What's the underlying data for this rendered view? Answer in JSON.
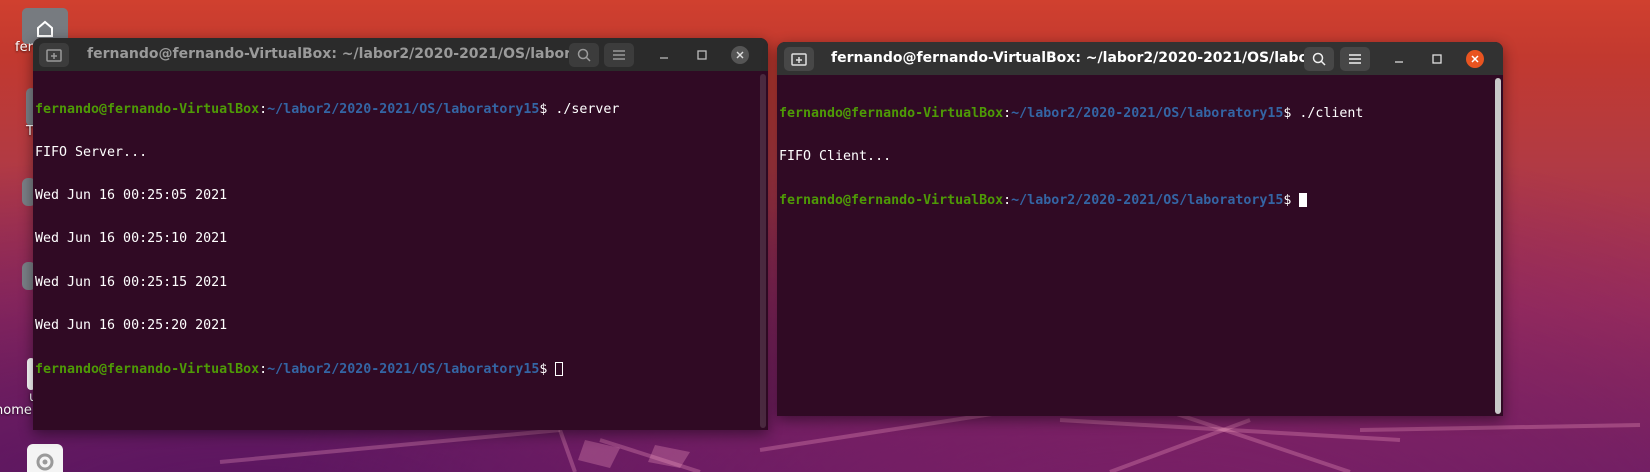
{
  "desktop": {
    "icons": [
      {
        "name": "home-folder-icon",
        "label_fragment": "fer"
      },
      {
        "name": "folder-icon-2",
        "label_fragment": "T"
      },
      {
        "name": "folder-icon-3",
        "label_fragment": ""
      },
      {
        "name": "folder-icon-4",
        "label_fragment": ""
      },
      {
        "name": "file-icon-5",
        "label_fragment": "u"
      },
      {
        "name": "file-icon-5-label2",
        "label_fragment": "home"
      },
      {
        "name": "settings-app-icon",
        "label_fragment": ""
      }
    ]
  },
  "colors": {
    "terminal_bg": "#300a24",
    "prompt_user": "#4e9a06",
    "prompt_path": "#3465a4",
    "close_active": "#e95420"
  },
  "server_window": {
    "title": "fernando@fernando-VirtualBox: ~/labor2/2020-2021/OS/labora...",
    "new_tab_icon": "new-tab-icon",
    "search_icon": "search-icon",
    "menu_icon": "hamburger-menu-icon",
    "minimize_symbol": "_",
    "maximize_symbol": "□",
    "close_symbol": "✕",
    "lines": [
      {
        "user": "fernando@fernando-VirtualBox",
        "sep": ":",
        "path": "~/labor2/2020-2021/OS/laboratory15",
        "cmd": "$ ./server"
      },
      {
        "text": "FIFO Server..."
      },
      {
        "text": "Wed Jun 16 00:25:05 2021"
      },
      {
        "text": "Wed Jun 16 00:25:10 2021"
      },
      {
        "text": "Wed Jun 16 00:25:15 2021"
      },
      {
        "text": "Wed Jun 16 00:25:20 2021"
      },
      {
        "user": "fernando@fernando-VirtualBox",
        "sep": ":",
        "path": "~/labor2/2020-2021/OS/laboratory15",
        "cmd": "$ "
      }
    ]
  },
  "client_window": {
    "title": "fernando@fernando-VirtualBox: ~/labor2/2020-2021/OS/labor...",
    "new_tab_icon": "new-tab-icon",
    "search_icon": "search-icon",
    "menu_icon": "hamburger-menu-icon",
    "minimize_symbol": "_",
    "maximize_symbol": "□",
    "close_symbol": "✕",
    "lines": [
      {
        "user": "fernando@fernando-VirtualBox",
        "sep": ":",
        "path": "~/labor2/2020-2021/OS/laboratory15",
        "cmd": "$ ./client"
      },
      {
        "text": "FIFO Client..."
      },
      {
        "user": "fernando@fernando-VirtualBox",
        "sep": ":",
        "path": "~/labor2/2020-2021/OS/laboratory15",
        "cmd": "$ "
      }
    ]
  }
}
